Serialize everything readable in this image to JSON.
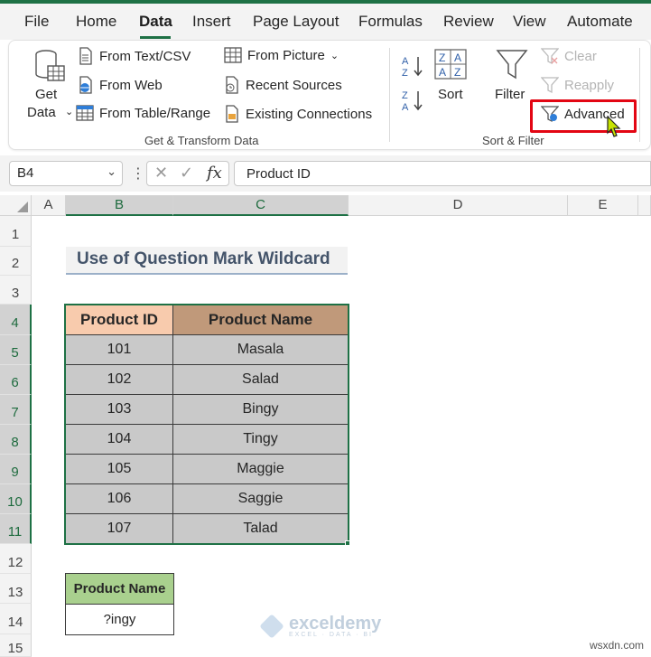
{
  "ribbon_tabs": [
    "File",
    "Home",
    "Data",
    "Insert",
    "Page Layout",
    "Formulas",
    "Review",
    "View",
    "Automate"
  ],
  "active_tab": "Data",
  "get_transform": {
    "get_data_label_1": "Get",
    "get_data_label_2": "Data",
    "from_text_csv": "From Text/CSV",
    "from_web": "From Web",
    "from_table_range": "From Table/Range",
    "from_picture": "From Picture",
    "recent_sources": "Recent Sources",
    "existing_connections": "Existing Connections",
    "group_label": "Get & Transform Data"
  },
  "sort_filter": {
    "sort": "Sort",
    "filter": "Filter",
    "clear": "Clear",
    "reapply": "Reapply",
    "advanced": "Advanced",
    "group_label": "Sort & Filter"
  },
  "formula_bar": {
    "name_box": "B4",
    "fx": "fx",
    "formula": "Product ID"
  },
  "columns": [
    "A",
    "B",
    "C",
    "D",
    "E"
  ],
  "rows": [
    "1",
    "2",
    "3",
    "4",
    "5",
    "6",
    "7",
    "8",
    "9",
    "10",
    "11",
    "12",
    "13",
    "14",
    "15"
  ],
  "sheet": {
    "title": "Use of Question Mark Wildcard",
    "table_headers": [
      "Product ID",
      "Product Name"
    ],
    "table_rows": [
      [
        "101",
        "Masala"
      ],
      [
        "102",
        "Salad"
      ],
      [
        "103",
        "Bingy"
      ],
      [
        "104",
        "Tingy"
      ],
      [
        "105",
        "Maggie"
      ],
      [
        "106",
        "Saggie"
      ],
      [
        "107",
        "Talad"
      ]
    ],
    "criteria_header": "Product Name",
    "criteria_value": "?ingy"
  },
  "watermark": {
    "name": "exceldemy",
    "tagline": "EXCEL · DATA · BI"
  },
  "site_mark": "wsxdn.com",
  "colors": {
    "excel_green": "#1e7145",
    "header_id_fill": "#f8cbad",
    "header_name_fill": "#c0997a",
    "data_fill": "#c9c9c9",
    "criteria_fill": "#a9d08e",
    "highlight_red": "#e30613"
  }
}
